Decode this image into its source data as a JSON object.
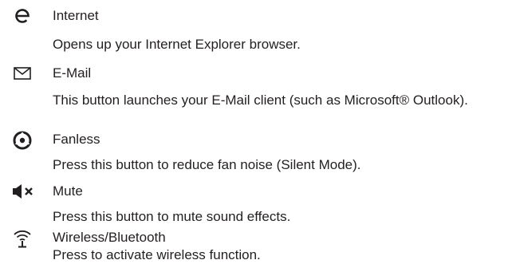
{
  "colors": {
    "text": "#231f20",
    "icon": "#231f20"
  },
  "items": [
    {
      "icon": "internet-explorer-icon",
      "title": "Internet",
      "description": "Opens up your Internet Explorer browser."
    },
    {
      "icon": "envelope-icon",
      "title": "E-Mail",
      "description": "This button launches your E-Mail client (such as Microsoft® Outlook)."
    },
    {
      "icon": "fanless-icon",
      "title": "Fanless",
      "description": "Press this button to reduce fan noise (Silent Mode)."
    },
    {
      "icon": "mute-icon",
      "title": "Mute",
      "description": "Press this button to mute sound effects."
    },
    {
      "icon": "wireless-icon",
      "title": "Wireless/Bluetooth",
      "description": "Press to activate wireless function."
    }
  ]
}
